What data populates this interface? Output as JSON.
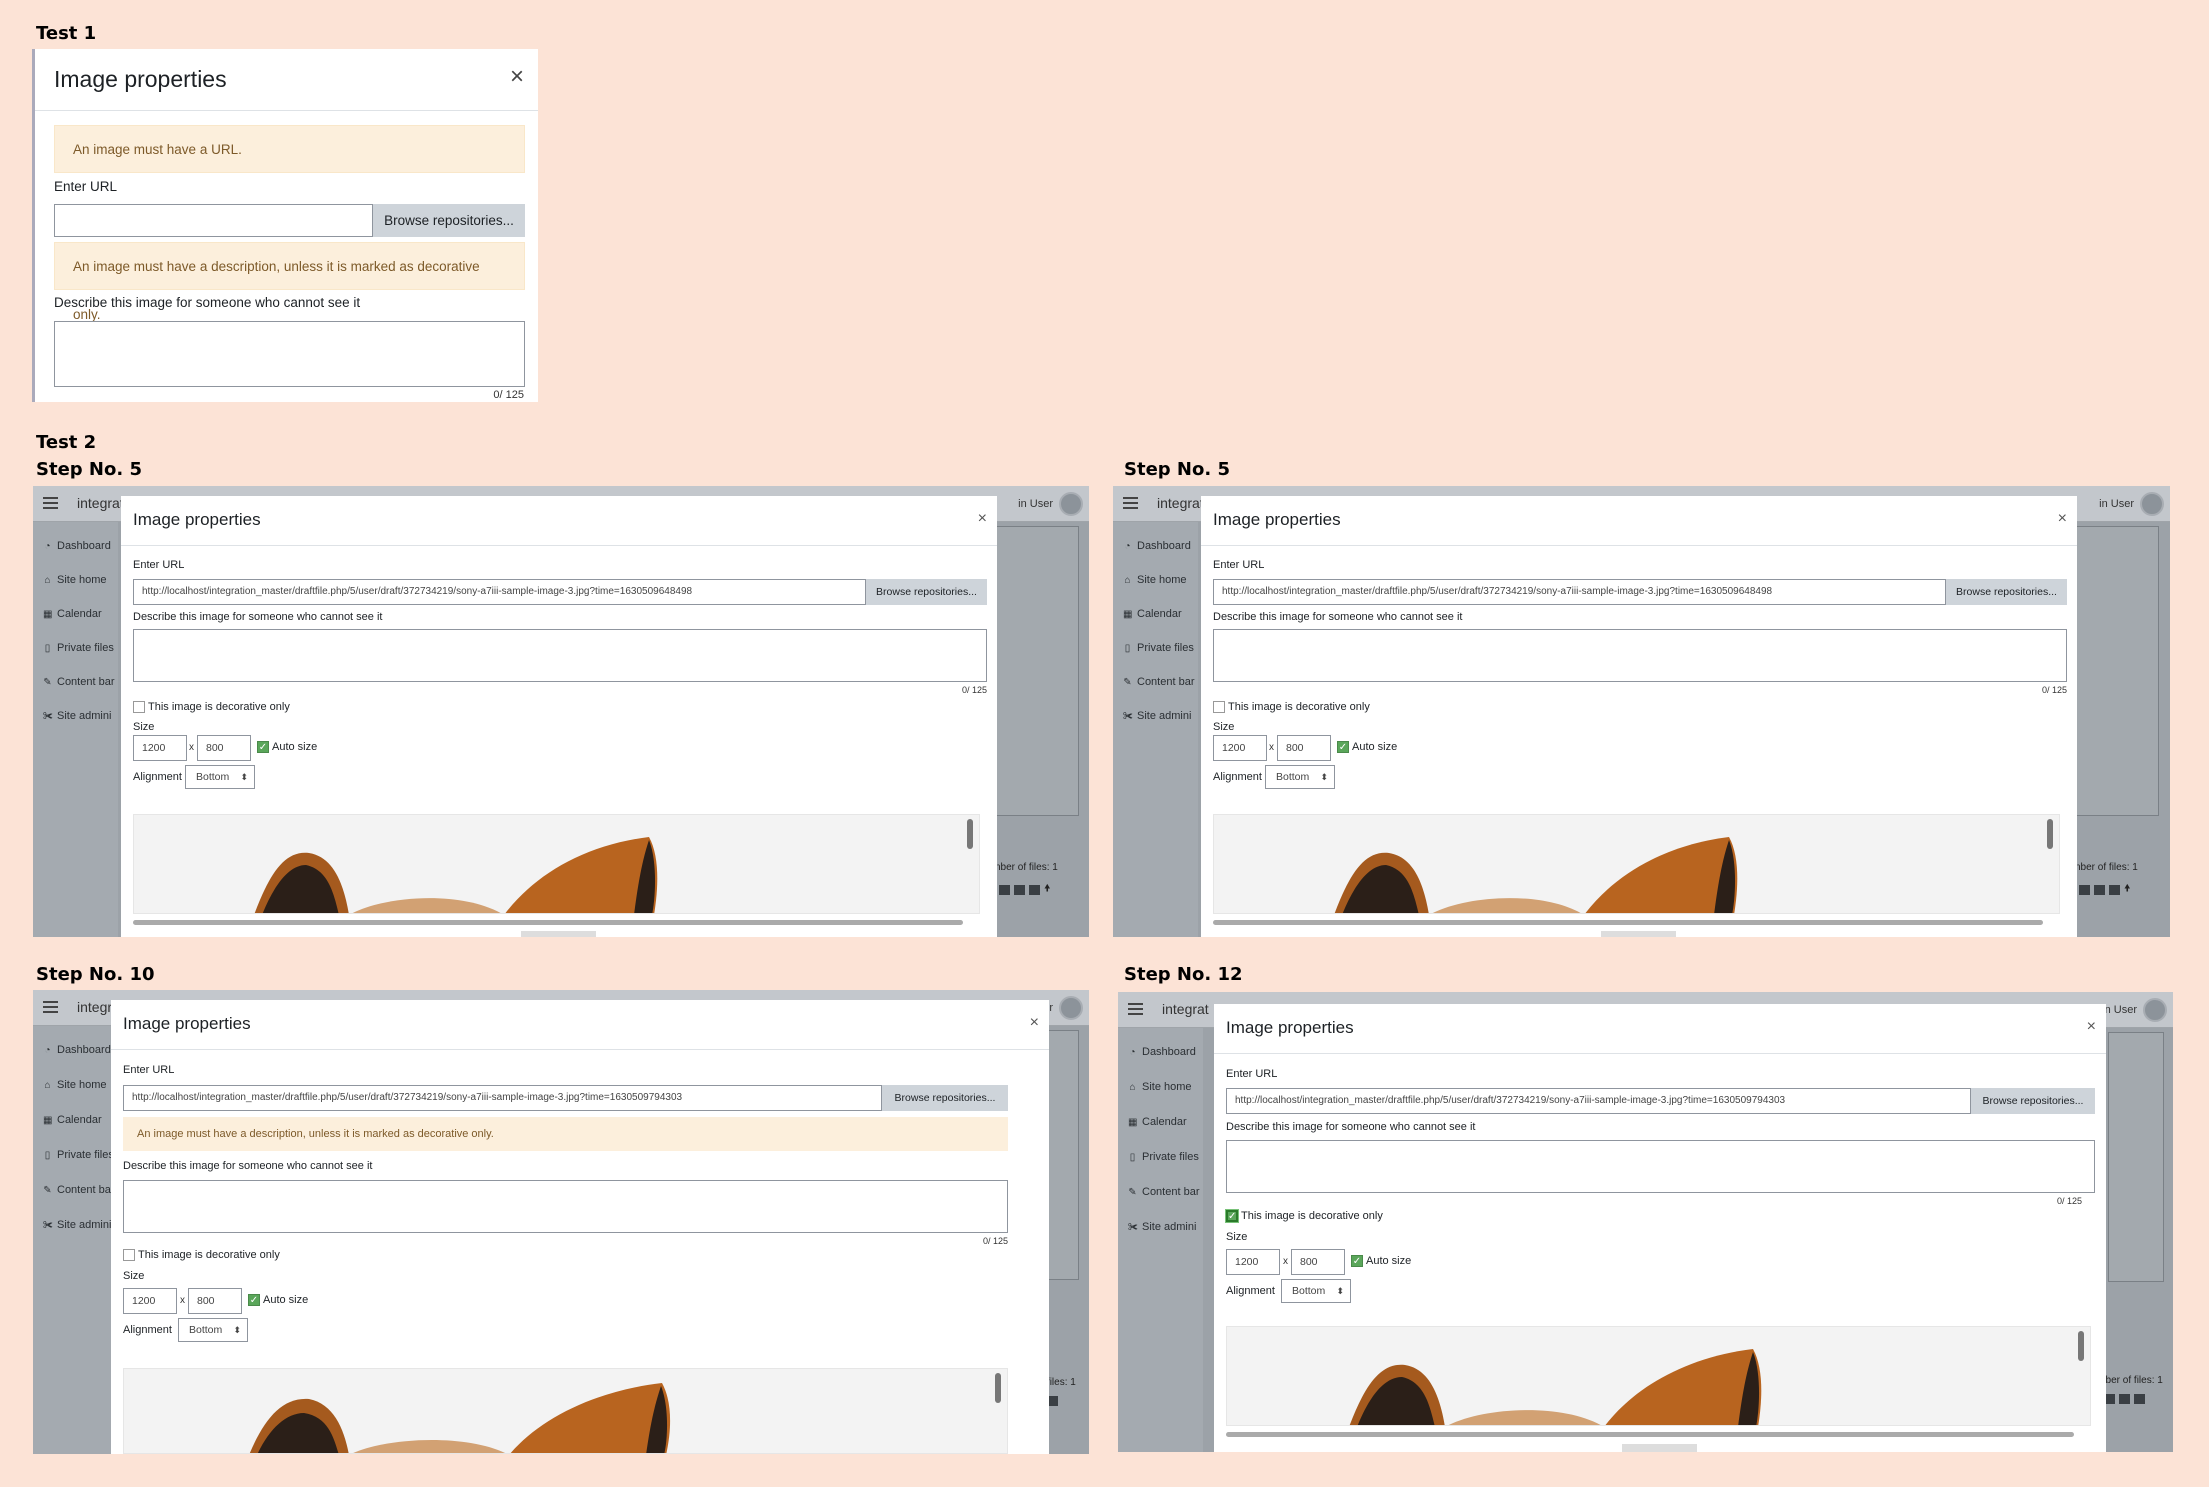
{
  "headings": {
    "test1": "Test 1",
    "test2": "Test 2",
    "step_a": "Step No. 5",
    "step_b": "Step No. 5",
    "step_c": "Step No. 10",
    "step_d": "Step No. 12"
  },
  "test1": {
    "title": "Image properties",
    "close": "×",
    "alert_url": "An image must have a URL.",
    "enter_url": "Enter URL",
    "url_value": "",
    "browse": "Browse repositories...",
    "alert_desc": "An image must have a description, unless it is marked as decorative only.",
    "describe_label": "Describe this image for someone who cannot see it",
    "counter": "0/ 125"
  },
  "background": {
    "site_name": "integrat",
    "user": "in User",
    "sidebar": [
      "Dashboard",
      "Site home",
      "Calendar",
      "Private files",
      "Content bar",
      "Site admini"
    ],
    "files_label": "nber of files: 1"
  },
  "dialog": {
    "title": "Image properties",
    "close": "×",
    "enter_url": "Enter URL",
    "browse": "Browse repositories...",
    "describe_label": "Describe this image for someone who cannot see it",
    "counter": "0/ 125",
    "decorative": "This image is decorative only",
    "size_label": "Size",
    "width": "1200",
    "height": "800",
    "times": "x",
    "autosize": "Auto size",
    "alignment_label": "Alignment",
    "alignment_value": "Bottom",
    "alert_desc": "An image must have a description, unless it is marked as decorative only."
  },
  "urls": {
    "step5": "http://localhost/integration_master/draftfile.php/5/user/draft/372734219/sony-a7iii-sample-image-3.jpg?time=1630509648498",
    "step10": "http://localhost/integration_master/draftfile.php/5/user/draft/372734219/sony-a7iii-sample-image-3.jpg?time=1630509794303",
    "step12": "http://localhost/integration_master/draftfile.php/5/user/draft/372734219/sony-a7iii-sample-image-3.jpg?time=1630509794303"
  },
  "state": {
    "step5a_decorative": false,
    "step5b_decorative": false,
    "step10_decorative": false,
    "step12_decorative": true,
    "autosize_checked": true
  },
  "icons": {
    "close": "close-icon",
    "menu": "hamburger-icon",
    "avatar": "user-avatar-icon",
    "dashboard": "dashboard-icon",
    "home": "home-icon",
    "calendar": "calendar-icon",
    "file": "file-icon",
    "brush": "brush-icon",
    "wrench": "wrench-icon"
  },
  "colors": {
    "page_bg": "#fce3d6",
    "alert_bg": "#fcefdc",
    "alert_text": "#7d5a29",
    "checkbox_on": "#5aa65a"
  }
}
